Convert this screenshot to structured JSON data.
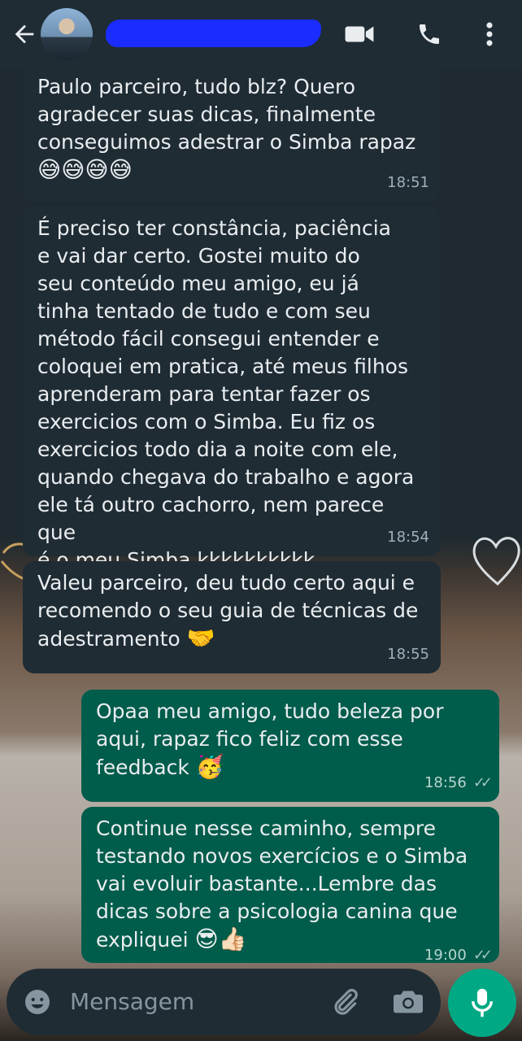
{
  "header": {
    "contact_name": "",
    "icons": [
      "back-arrow-icon",
      "video-call-icon",
      "phone-icon",
      "more-vert-icon"
    ]
  },
  "messages": [
    {
      "direction": "in",
      "text": "Paulo parceiro, tudo blz? Quero\nagradecer suas dicas, finalmente\nconseguimos adestrar o Simba rapaz",
      "emoji": "😅😅😅😅",
      "time": "18:51"
    },
    {
      "direction": "in",
      "text": "É preciso ter constância, paciência\ne vai dar certo. Gostei muito do\nseu conteúdo meu amigo, eu já\ntinha tentado de tudo e com seu\nmétodo fácil consegui entender e\ncoloquei em pratica, até meus filhos\naprenderam para tentar fazer os\nexercicios com o Simba. Eu fiz os\nexercicios todo dia a noite com ele,\nquando chegava do trabalho e agora\nele tá outro cachorro, nem parece que\né o meu Simba kkkkkkkkkk",
      "time": "18:54"
    },
    {
      "direction": "in",
      "text": "Valeu parceiro, deu tudo certo aqui e\nrecomendo o seu guia de técnicas de\nadestramento",
      "emoji": "🤝",
      "time": "18:55"
    },
    {
      "direction": "out",
      "text": "Opaa meu amigo, tudo beleza por\naqui, rapaz fico feliz com esse\nfeedback",
      "emoji": "🥳",
      "time": "18:56"
    },
    {
      "direction": "out",
      "text": "Continue nesse caminho, sempre\ntestando novos exercícios e o Simba\nvai evoluir bastante...Lembre das\ndicas sobre a psicologia canina que\nexpliquei",
      "emoji": "😎👍🏻",
      "time": "19:00"
    }
  ],
  "composer": {
    "placeholder": "Mensagem",
    "icons": [
      "emoji-icon",
      "attach-icon",
      "camera-icon",
      "mic-icon"
    ]
  },
  "colors": {
    "header_bg": "#1f2c34",
    "incoming_bubble": "#1f2c34",
    "outgoing_bubble": "#005c4b",
    "accent": "#00a884",
    "name_redaction": "#1a2cff"
  }
}
